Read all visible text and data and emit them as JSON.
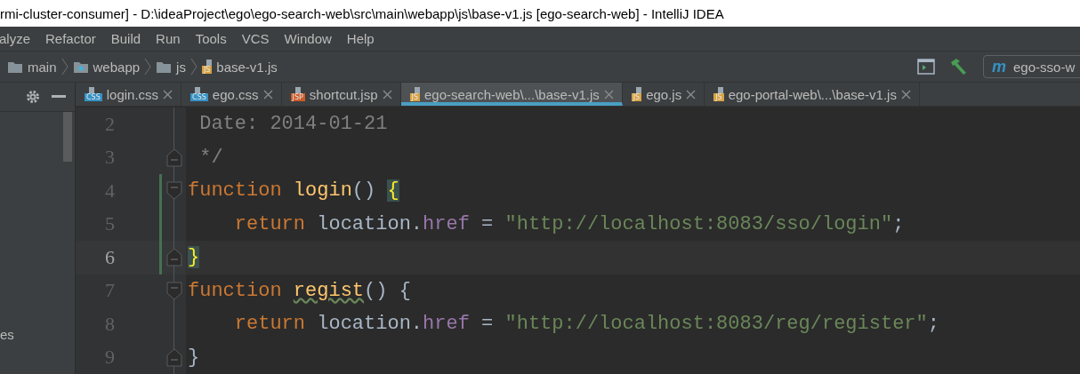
{
  "window": {
    "title": "rmi-cluster-consumer] - D:\\ideaProject\\ego\\ego-search-web\\src\\main\\webapp\\js\\base-v1.js [ego-search-web] - IntelliJ IDEA"
  },
  "menu": [
    "alyze",
    "Refactor",
    "Build",
    "Run",
    "Tools",
    "VCS",
    "Window",
    "Help"
  ],
  "breadcrumb": [
    {
      "label": "main",
      "kind": "folder"
    },
    {
      "label": "webapp",
      "kind": "web-folder"
    },
    {
      "label": "js",
      "kind": "folder"
    },
    {
      "label": "base-v1.js",
      "kind": "file",
      "badge": "JS",
      "color": "#d9a343"
    }
  ],
  "run_config": {
    "icon": "m",
    "label": "ego-sso-w"
  },
  "tabs": [
    {
      "label": "login.css",
      "badge": "CSS",
      "color": "#3592c4",
      "selected": false
    },
    {
      "label": "ego.css",
      "badge": "CSS",
      "color": "#3592c4",
      "selected": false
    },
    {
      "label": "shortcut.jsp",
      "badge": "JSP",
      "color": "#cc5a28",
      "selected": false
    },
    {
      "label": "ego-search-web\\...\\base-v1.js",
      "badge": "JS",
      "color": "#d9a343",
      "selected": true
    },
    {
      "label": "ego.js",
      "badge": "JS",
      "color": "#d9a343",
      "selected": false
    },
    {
      "label": "ego-portal-web\\...\\base-v1.js",
      "badge": "JS",
      "color": "#d9a343",
      "selected": false
    }
  ],
  "project_panel": {
    "text": "es"
  },
  "code_lines": [
    {
      "number": "2",
      "current": false,
      "changed": false,
      "fold_start": false,
      "fold_end": false,
      "tokens": [
        {
          "kind": "comment",
          "text": " Date: 2014-01-21"
        }
      ]
    },
    {
      "number": "3",
      "current": false,
      "changed": false,
      "fold_start": false,
      "fold_end": true,
      "tokens": [
        {
          "kind": "comment",
          "text": " */"
        }
      ]
    },
    {
      "number": "4",
      "current": false,
      "changed": true,
      "fold_start": true,
      "fold_end": false,
      "tokens": [
        {
          "kind": "keyword",
          "text": "function "
        },
        {
          "kind": "name",
          "text": "login"
        },
        {
          "kind": "plain",
          "text": "() "
        },
        {
          "kind": "brace-match",
          "text": "{"
        }
      ]
    },
    {
      "number": "5",
      "current": false,
      "changed": true,
      "fold_start": false,
      "fold_end": false,
      "tokens": [
        {
          "kind": "keyword",
          "text": "    return "
        },
        {
          "kind": "plain",
          "text": "location."
        },
        {
          "kind": "property",
          "text": "href"
        },
        {
          "kind": "plain",
          "text": " = "
        },
        {
          "kind": "string",
          "text": "\"http://localhost:8083/sso/login\""
        },
        {
          "kind": "plain",
          "text": ";"
        }
      ]
    },
    {
      "number": "6",
      "current": true,
      "changed": true,
      "fold_start": false,
      "fold_end": true,
      "tokens": [
        {
          "kind": "brace-match",
          "text": "}"
        }
      ]
    },
    {
      "number": "7",
      "current": false,
      "changed": false,
      "fold_start": true,
      "fold_end": false,
      "tokens": [
        {
          "kind": "keyword",
          "text": "function "
        },
        {
          "kind": "warning-name",
          "text": "regist"
        },
        {
          "kind": "plain",
          "text": "() "
        },
        {
          "kind": "brace",
          "text": "{"
        }
      ]
    },
    {
      "number": "8",
      "current": false,
      "changed": false,
      "fold_start": false,
      "fold_end": false,
      "tokens": [
        {
          "kind": "keyword",
          "text": "    return "
        },
        {
          "kind": "plain",
          "text": "location."
        },
        {
          "kind": "property",
          "text": "href"
        },
        {
          "kind": "plain",
          "text": " = "
        },
        {
          "kind": "string",
          "text": "\"http://localhost:8083/reg/register\""
        },
        {
          "kind": "plain",
          "text": ";"
        }
      ]
    },
    {
      "number": "9",
      "current": false,
      "changed": false,
      "fold_start": false,
      "fold_end": true,
      "tokens": [
        {
          "kind": "brace",
          "text": "}"
        }
      ]
    }
  ]
}
